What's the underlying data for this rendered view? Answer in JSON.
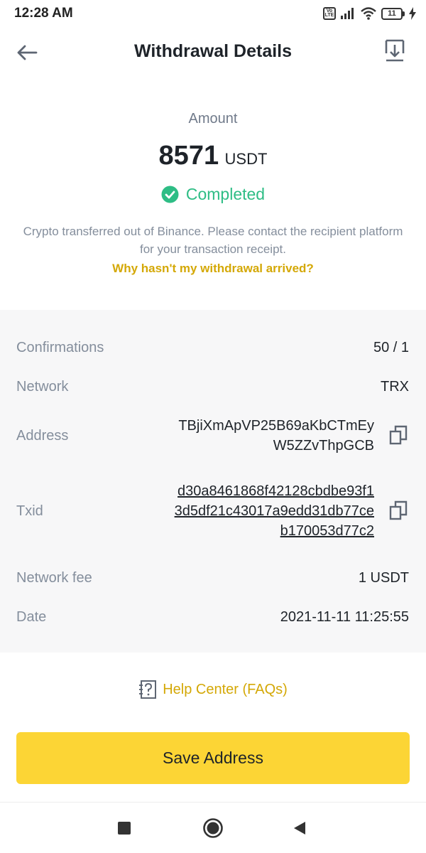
{
  "status_bar": {
    "time": "12:28 AM",
    "volte": "Vo LTE",
    "battery": "11"
  },
  "header": {
    "title": "Withdrawal Details",
    "back_icon": "arrow-left-icon",
    "download_icon": "download-icon"
  },
  "summary": {
    "amount_label": "Amount",
    "amount_value": "8571",
    "amount_unit": "USDT",
    "status": "Completed",
    "description": "Crypto transferred out of Binance. Please contact the recipient platform for your transaction receipt.",
    "why_link": "Why hasn't my withdrawal arrived?"
  },
  "details": {
    "confirmations_label": "Confirmations",
    "confirmations_value": "50 / 1",
    "network_label": "Network",
    "network_value": "TRX",
    "address_label": "Address",
    "address_line1": "TBjiXmApVP25B69aKbCTmEy",
    "address_line2": "W5ZZvThpGCB",
    "txid_label": "Txid",
    "txid_line1": "d30a8461868f42128cbdbe93f1",
    "txid_line2": "3d5df21c43017a9edd31db77ce",
    "txid_line3": "b170053d77c2",
    "fee_label": "Network fee",
    "fee_value": "1 USDT",
    "date_label": "Date",
    "date_value": "2021-11-11 11:25:55"
  },
  "help": {
    "label": "Help Center (FAQs)"
  },
  "actions": {
    "save_address": "Save Address"
  },
  "colors": {
    "accent_yellow": "#fcd535",
    "link_gold": "#d4a806",
    "success_green": "#2ebd85",
    "muted_text": "#848e9c"
  }
}
